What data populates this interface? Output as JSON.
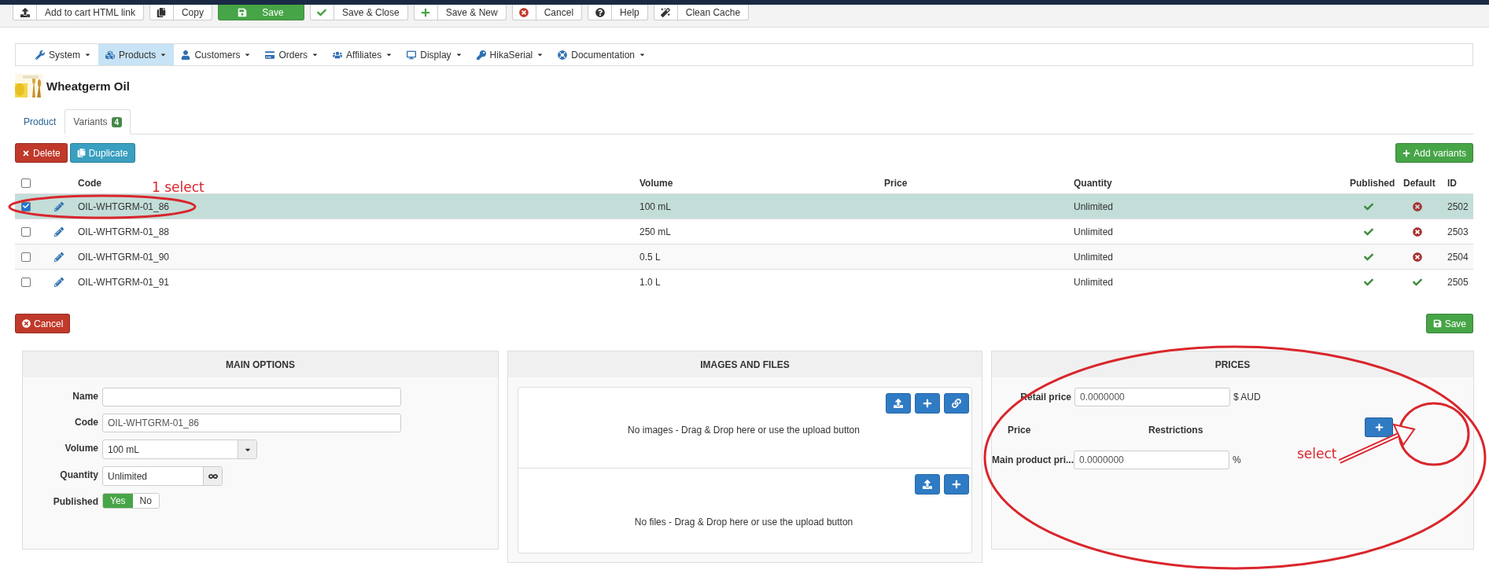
{
  "toolbar": [
    {
      "label": "Add to cart HTML link",
      "kind": "default"
    },
    {
      "label": "Copy",
      "kind": "default"
    },
    {
      "label": "Save",
      "kind": "success"
    },
    {
      "label": "Save & Close",
      "kind": "default"
    },
    {
      "label": "Save & New",
      "kind": "default"
    },
    {
      "label": "Cancel",
      "kind": "default"
    },
    {
      "label": "Help",
      "kind": "default"
    },
    {
      "label": "Clean Cache",
      "kind": "default"
    }
  ],
  "menu": [
    {
      "label": "System",
      "selected": false
    },
    {
      "label": "Products",
      "selected": true
    },
    {
      "label": "Customers",
      "selected": false
    },
    {
      "label": "Orders",
      "selected": false
    },
    {
      "label": "Affiliates",
      "selected": false
    },
    {
      "label": "Display",
      "selected": false
    },
    {
      "label": "HikaSerial",
      "selected": false
    },
    {
      "label": "Documentation",
      "selected": false
    }
  ],
  "product": {
    "title": "Wheatgerm Oil"
  },
  "tabs": [
    {
      "label": "Product",
      "selected": false
    },
    {
      "label": "Variants",
      "badge": "4",
      "selected": true
    }
  ],
  "actions": {
    "delete": "Delete",
    "duplicate": "Duplicate",
    "add": "Add variants"
  },
  "table": {
    "header_checked": false,
    "columns": [
      "Code",
      "Volume",
      "Price",
      "Quantity",
      "Published",
      "Default",
      "ID"
    ],
    "rows": [
      {
        "checked": true,
        "selected": true,
        "code": "OIL-WHTGRM-01_86",
        "volume": "100 mL",
        "quantity": "Unlimited",
        "published": true,
        "default": false,
        "id": "2502"
      },
      {
        "checked": false,
        "selected": false,
        "code": "OIL-WHTGRM-01_88",
        "volume": "250 mL",
        "quantity": "Unlimited",
        "published": true,
        "default": false,
        "id": "2503"
      },
      {
        "checked": false,
        "selected": false,
        "code": "OIL-WHTGRM-01_90",
        "volume": "0.5 L",
        "quantity": "Unlimited",
        "published": true,
        "default": false,
        "id": "2504"
      },
      {
        "checked": false,
        "selected": false,
        "code": "OIL-WHTGRM-01_91",
        "volume": "1.0 L",
        "quantity": "Unlimited",
        "published": true,
        "default": true,
        "id": "2505"
      }
    ]
  },
  "form": {
    "cancel": "Cancel",
    "save": "Save",
    "main_options": {
      "title": "MAIN OPTIONS",
      "fields": [
        {
          "kind": "text",
          "label": "Name"
        },
        {
          "kind": "text",
          "label": "Code",
          "value": "OIL-WHTGRM-01_86"
        },
        {
          "kind": "select",
          "label": "Volume",
          "value": "100 mL"
        },
        {
          "kind": "quantity",
          "label": "Quantity",
          "value": "Unlimited"
        },
        {
          "kind": "toggle",
          "label": "Published",
          "options": [
            {
              "label": "Yes",
              "selected": true
            },
            {
              "label": "No",
              "selected": false
            }
          ]
        }
      ]
    },
    "images_and_files": {
      "title": "IMAGES AND FILES",
      "images_text": "No images - Drag & Drop here or use the upload button",
      "files_text": "No files - Drag & Drop here or use the upload button"
    },
    "prices": {
      "title": "PRICES",
      "retail_label": "Retail price",
      "retail_value": "0.0000000",
      "currency": "$ AUD",
      "columns": [
        "Price",
        "Restrictions"
      ],
      "main_label": "Main product pri...",
      "main_value": "0.0000000",
      "unit": "%"
    }
  },
  "annotations": [
    {
      "text": "1 select"
    },
    {
      "text": "select"
    }
  ]
}
